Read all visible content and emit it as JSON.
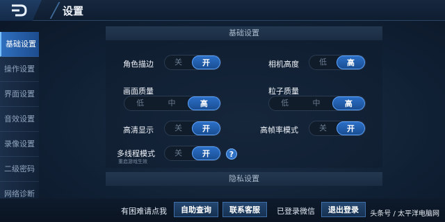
{
  "header": {
    "title": "设置"
  },
  "sidebar": {
    "items": [
      {
        "label": "基础设置",
        "active": true
      },
      {
        "label": "操作设置"
      },
      {
        "label": "界面设置"
      },
      {
        "label": "音效设置"
      },
      {
        "label": "录像设置"
      },
      {
        "label": "二级密码"
      },
      {
        "label": "网络诊断"
      }
    ]
  },
  "basic": {
    "title": "基础设置",
    "character_outline": {
      "label": "角色描边",
      "options": [
        "关",
        "开"
      ],
      "selected": "开"
    },
    "camera_height": {
      "label": "相机高度",
      "options": [
        "低",
        "高"
      ],
      "selected": "高"
    },
    "graphics_quality": {
      "label": "画面质量",
      "options": [
        "低",
        "中",
        "高"
      ],
      "selected": "高"
    },
    "particle_quality": {
      "label": "粒子质量",
      "options": [
        "低",
        "中",
        "高"
      ],
      "selected": "高"
    },
    "hd_display": {
      "label": "高清显示",
      "options": [
        "关",
        "开"
      ],
      "selected": "开"
    },
    "high_fps": {
      "label": "高帧率模式",
      "options": [
        "关",
        "开"
      ],
      "selected": "开"
    },
    "multithread": {
      "label": "多线程模式",
      "sublabel": "重启游戏生效",
      "options": [
        "关",
        "开"
      ],
      "selected": "开"
    },
    "help_icon": "?"
  },
  "privacy": {
    "title": "隐私设置"
  },
  "footer": {
    "help_text": "有困难请点我",
    "self_query": "自助查询",
    "contact_service": "联系客服",
    "login_status": "已登录微信",
    "logout": "退出登录"
  },
  "watermark": "头条号 / 太平洋电脑网",
  "colors": {
    "accent": "#2c6fc6",
    "background": "#102034"
  }
}
